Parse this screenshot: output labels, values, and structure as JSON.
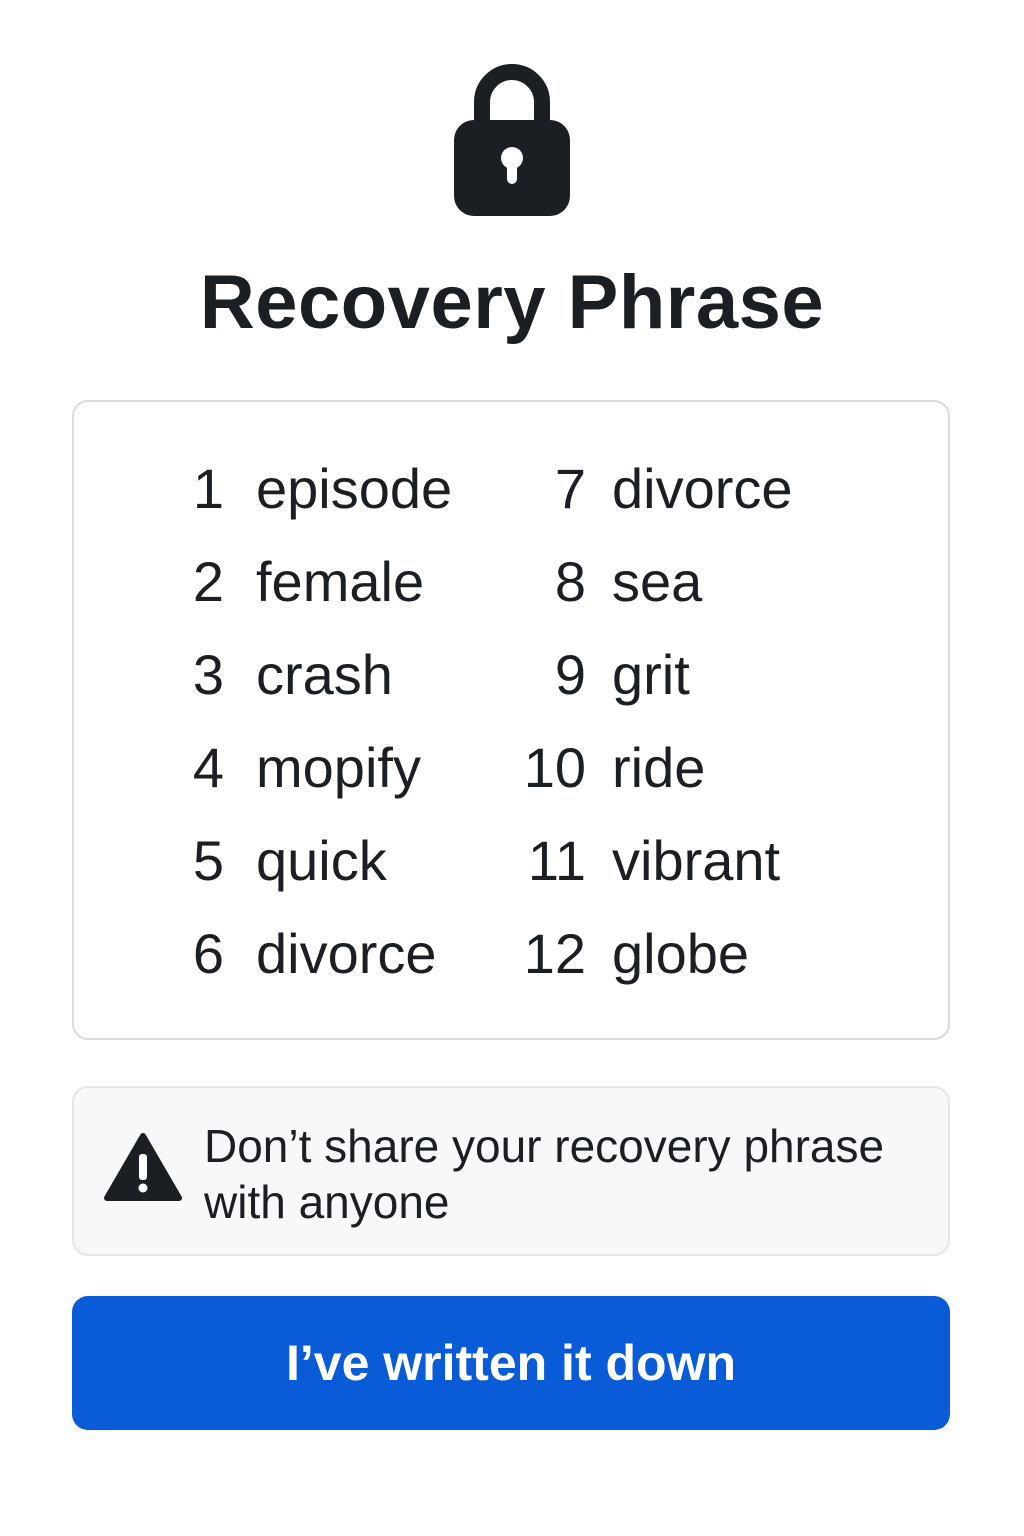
{
  "header": {
    "icon": "lock-icon",
    "title": "Recovery Phrase"
  },
  "phrase": {
    "words": [
      {
        "num": "1",
        "word": "episode"
      },
      {
        "num": "2",
        "word": "female"
      },
      {
        "num": "3",
        "word": "crash"
      },
      {
        "num": "4",
        "word": "mopify"
      },
      {
        "num": "5",
        "word": "quick"
      },
      {
        "num": "6",
        "word": "divorce"
      },
      {
        "num": "7",
        "word": "divorce"
      },
      {
        "num": "8",
        "word": "sea"
      },
      {
        "num": "9",
        "word": "grit"
      },
      {
        "num": "10",
        "word": "ride"
      },
      {
        "num": "11",
        "word": "vibrant"
      },
      {
        "num": "12",
        "word": "globe"
      }
    ]
  },
  "warning": {
    "icon": "warning-icon",
    "text": "Don’t share your recovery phrase with anyone"
  },
  "actions": {
    "confirm_label": "I’ve written it down"
  },
  "colors": {
    "text": "#1b1f24",
    "primary": "#0a5bd8",
    "card_border": "#d9dbde",
    "warning_bg": "#f7f8f9"
  }
}
